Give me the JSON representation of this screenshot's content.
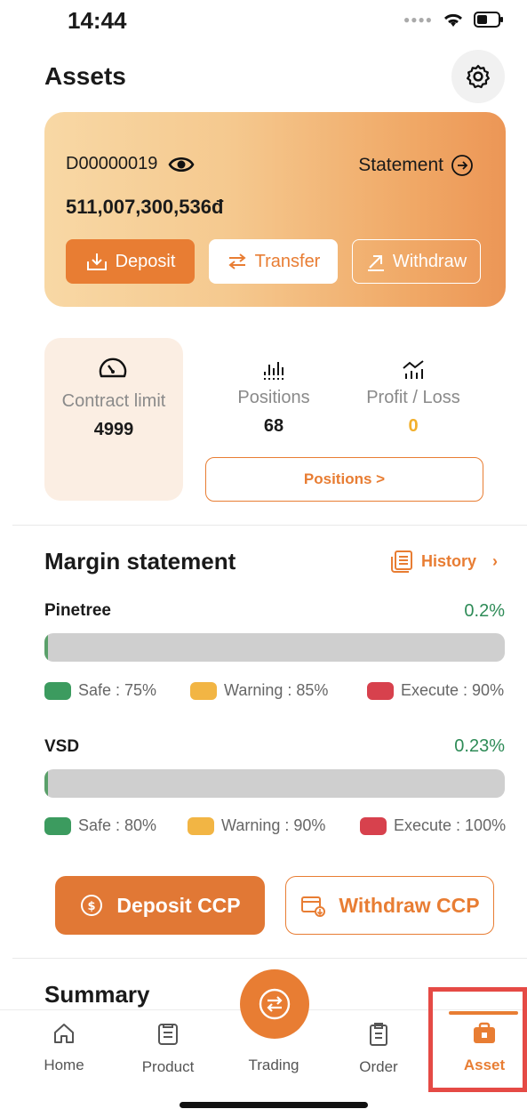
{
  "status_bar": {
    "time": "14:44"
  },
  "header": {
    "title": "Assets"
  },
  "account": {
    "id": "D00000019",
    "statement_label": "Statement",
    "balance": "511,007,300,536đ",
    "deposit_label": "Deposit",
    "transfer_label": "Transfer",
    "withdraw_label": "Withdraw"
  },
  "contract": {
    "limit_label": "Contract limit",
    "limit_value": "4999",
    "positions_label": "Positions",
    "positions_value": "68",
    "pl_label": "Profit / Loss",
    "pl_value": "0",
    "positions_button": "Positions >"
  },
  "margin": {
    "title": "Margin statement",
    "history_label": "History",
    "rows": [
      {
        "name": "Pinetree",
        "pct": "0.2%",
        "fill_fraction": 0.002,
        "safe": "Safe : 75%",
        "warning": "Warning : 85%",
        "execute": "Execute : 90%"
      },
      {
        "name": "VSD",
        "pct": "0.23%",
        "fill_fraction": 0.0023,
        "safe": "Safe : 80%",
        "warning": "Warning : 90%",
        "execute": "Execute : 100%"
      }
    ],
    "deposit_ccp": "Deposit CCP",
    "withdraw_ccp": "Withdraw CCP"
  },
  "summary": {
    "title": "Summary"
  },
  "tabs": [
    {
      "label": "Home",
      "icon": "home-icon"
    },
    {
      "label": "Product",
      "icon": "product-icon"
    },
    {
      "label": "Trading",
      "icon": "trading-icon"
    },
    {
      "label": "Order",
      "icon": "order-icon"
    },
    {
      "label": "Asset",
      "icon": "asset-icon",
      "active": true
    }
  ],
  "colors": {
    "accent": "#e87d33",
    "profit": "#2e8b57",
    "highlight_frame": "#e54a45"
  }
}
